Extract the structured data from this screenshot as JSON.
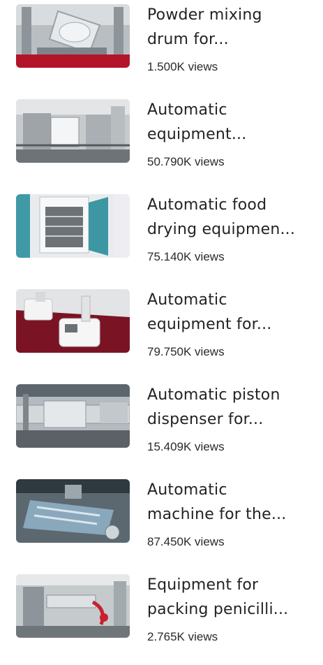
{
  "videos": [
    {
      "title_line1": "Powder mixing",
      "title_line2": "drum for...",
      "views": "1.500K views",
      "thumb_icon": "powder-mixing-drum-thumbnail"
    },
    {
      "title_line1": "Automatic",
      "title_line2": "equipment...",
      "views": "50.790K views",
      "thumb_icon": "automatic-equipment-thumbnail"
    },
    {
      "title_line1": "Automatic food",
      "title_line2": "drying equipmen...",
      "views": "75.140K views",
      "thumb_icon": "food-drying-oven-thumbnail"
    },
    {
      "title_line1": "Automatic",
      "title_line2": "equipment for...",
      "views": "79.750K views",
      "thumb_icon": "lab-equipment-thumbnail"
    },
    {
      "title_line1": "Automatic piston",
      "title_line2": "dispenser for...",
      "views": "15.409K views",
      "thumb_icon": "piston-dispenser-thumbnail"
    },
    {
      "title_line1": "Automatic",
      "title_line2": "machine for the...",
      "views": "87.450K views",
      "thumb_icon": "packaging-machine-thumbnail"
    },
    {
      "title_line1": "Equipment for",
      "title_line2": "packing penicilli...",
      "views": "2.765K views",
      "thumb_icon": "penicillin-packing-thumbnail"
    }
  ],
  "colors": {
    "title": "#232323",
    "views": "#2a2a2a",
    "background": "#ffffff"
  }
}
